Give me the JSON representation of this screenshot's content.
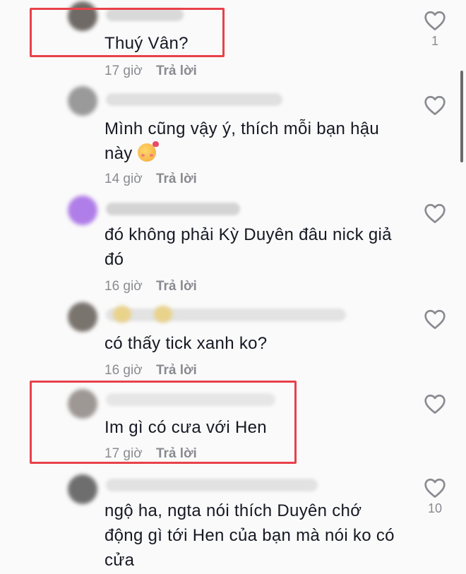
{
  "comments": [
    {
      "text": "Thuý Vân?",
      "time": "17 giờ",
      "reply": "Trả lời",
      "likes": "1",
      "avatar_color": "#6f6a66",
      "highlighted": true
    },
    {
      "text": "Mình cũng vậy ý, thích mỗi bạn hậu này",
      "emoji": "smiling-face-with-hearts",
      "time": "14 giờ",
      "reply": "Trả lời",
      "likes": "",
      "avatar_color": "#9a9a9a",
      "highlighted": false
    },
    {
      "text": "đó không phải Kỳ Duyên đâu nick giả đó",
      "time": "16 giờ",
      "reply": "Trả lời",
      "likes": "",
      "avatar_color": "#b07ee8",
      "highlighted": false
    },
    {
      "text": "có thấy tick xanh ko?",
      "time": "16 giờ",
      "reply": "Trả lời",
      "likes": "",
      "avatar_color": "#7a746e",
      "highlighted": false
    },
    {
      "text": "Im gì có cưa với Hen",
      "time": "17 giờ",
      "reply": "Trả lời",
      "likes": "",
      "avatar_color": "#9e9894",
      "highlighted": true
    },
    {
      "text": "ngộ ha, ngta nói thích Duyên chớ động gì tới Hen của bạn mà nói ko có cửa",
      "time": "",
      "reply": "",
      "likes": "10",
      "avatar_color": "#6e6e6e",
      "highlighted": false
    }
  ],
  "colors": {
    "highlight": "#e8414a",
    "meta_text": "#8a8b91",
    "body_text": "#161823",
    "background": "#fafafa"
  },
  "icons": {
    "like": "heart-outline-icon",
    "emoji": "smiling-face-with-hearts"
  }
}
